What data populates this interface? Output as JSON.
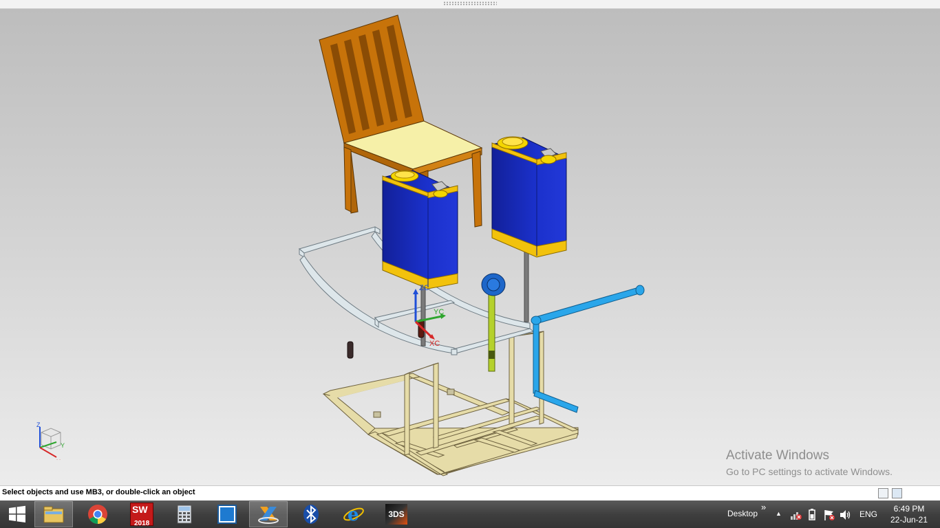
{
  "status": {
    "prompt": "Select objects and use MB3, or double-click an object"
  },
  "viewport": {
    "csys_labels": {
      "z": "ZC",
      "y": "YC",
      "x": "XC"
    },
    "triad_labels": {
      "z": "Z",
      "y": "Y",
      "x": "X"
    }
  },
  "watermark": {
    "title": "Activate Windows",
    "subtitle": "Go to PC settings to activate Windows."
  },
  "taskbar": {
    "apps": [
      {
        "name": "start-button",
        "icon": "windows-logo-icon"
      },
      {
        "name": "file-explorer",
        "icon": "folder-icon"
      },
      {
        "name": "chrome",
        "icon": "chrome-icon"
      },
      {
        "name": "solidworks",
        "icon": "solidworks-icon",
        "badge": "2018",
        "label": "SW"
      },
      {
        "name": "calculator",
        "icon": "calculator-icon"
      },
      {
        "name": "window-app",
        "icon": "window-icon"
      },
      {
        "name": "nx",
        "icon": "nx-icon",
        "active": true
      },
      {
        "name": "bluetooth",
        "icon": "bluetooth-icon"
      },
      {
        "name": "internet-explorer",
        "icon": "ie-icon"
      },
      {
        "name": "3dexperience",
        "icon": "3ds-icon"
      }
    ],
    "desktop_label": "Desktop",
    "desktop_chevron": "»",
    "language": "ENG",
    "time": "6:49 PM",
    "date": "22-Jun-21"
  },
  "colors": {
    "tank_body": "#1a2fc8",
    "tank_band": "#f2c20c",
    "chair_wood": "#c7730a",
    "seat": "#f6f0a8",
    "frame": "#e6dca8",
    "pipe_blue": "#2aa6ea",
    "lime_rod": "#b5d12c",
    "silver_frame": "#dde6ea"
  }
}
